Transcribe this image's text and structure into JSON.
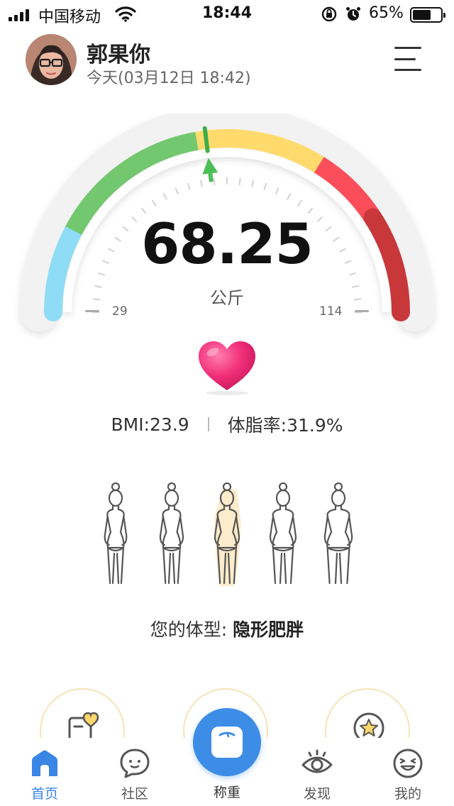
{
  "status_bar": {
    "carrier": "中国移动",
    "time": "18:44",
    "battery_percent": "65%",
    "battery_level": 0.65,
    "icons": [
      "signal-icon",
      "wifi-icon",
      "rotation-lock-icon",
      "alarm-icon",
      "battery-icon"
    ]
  },
  "header": {
    "user_name": "郭果你",
    "date_text": "今天(03月12日 18:42)",
    "menu_icon": "hamburger-menu-icon"
  },
  "gauge": {
    "weight": "68.25",
    "unit": "公斤",
    "scale_min": "29",
    "scale_max": "114",
    "weight_value": 68.25,
    "range_min": 29,
    "range_max": 114,
    "zone_colors": [
      "#8fdcf6",
      "#73c86f",
      "#ffdb6d",
      "#fb4e5a",
      "#c8373a"
    ]
  },
  "metrics": {
    "bmi": "BMI:23.9",
    "body_fat": "体脂率:31.9%"
  },
  "body_type": {
    "label_prefix": "您的体型: ",
    "label_value": "隐形肥胖",
    "selected_index": 2
  },
  "features": {
    "icons": [
      "health-report-icon",
      "",
      "star-badge-icon"
    ]
  },
  "tab_bar": {
    "tabs": [
      {
        "label": "首页",
        "icon": "home-icon"
      },
      {
        "label": "社区",
        "icon": "community-icon"
      },
      {
        "label": "称重",
        "icon": "scale-icon"
      },
      {
        "label": "发现",
        "icon": "discover-eye-icon"
      },
      {
        "label": "我的",
        "icon": "profile-smile-icon"
      }
    ],
    "active_index": 0
  }
}
